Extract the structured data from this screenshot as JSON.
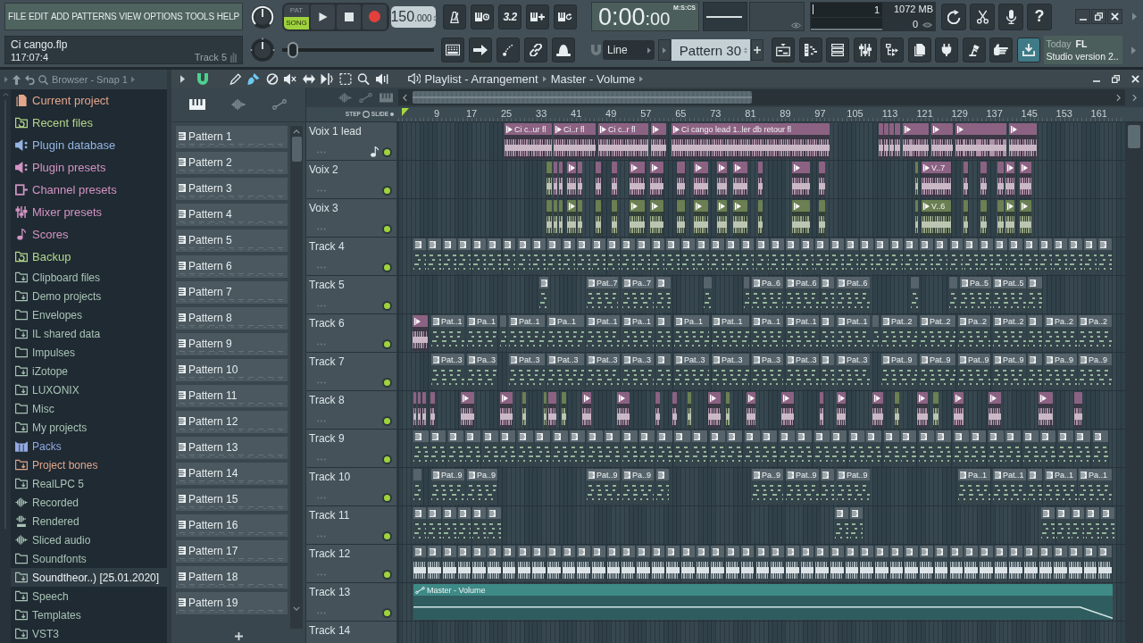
{
  "menu": [
    "FILE",
    "EDIT",
    "ADD",
    "PATTERNS",
    "VIEW",
    "OPTIONS",
    "TOOLS",
    "HELP"
  ],
  "project": {
    "file": "Ci cango.flp",
    "position": "117:07:4",
    "hint": "Track 5"
  },
  "transport": {
    "modes": [
      {
        "label": "PAT",
        "selected": false
      },
      {
        "label": "SONG",
        "selected": true
      }
    ],
    "tempo_whole": "150",
    "tempo_fraction": ".000",
    "countdown": "3.2",
    "pitch": {
      "level": 0.04
    }
  },
  "clock": {
    "time": "0:00",
    "fraction": ":00",
    "format": "M:S:CS"
  },
  "monitor": {
    "cpu": "1",
    "memory": "1072 MB",
    "voices": "0"
  },
  "help": "?",
  "snap": {
    "value": "Line"
  },
  "pattern_selector": {
    "value": "Pattern 30"
  },
  "news": {
    "date": "Today",
    "lines": [
      "FL",
      "Studio version 2.."
    ]
  },
  "browser": {
    "title": "Browser - Snap 1",
    "items": [
      {
        "label": "Current project",
        "kind": "document",
        "color": "#e2a58c",
        "selected": false
      },
      {
        "label": "Recent files",
        "kind": "recent",
        "color": "#b3d68a",
        "selected": false
      },
      {
        "label": "Plugin database",
        "kind": "plugin",
        "color": "#94b5e2",
        "selected": false
      },
      {
        "label": "Plugin presets",
        "kind": "plugin",
        "color": "#d493c4",
        "selected": false
      },
      {
        "label": "Channel presets",
        "kind": "channel",
        "color": "#d493c4",
        "selected": false
      },
      {
        "label": "Mixer presets",
        "kind": "mixer",
        "color": "#d493c4",
        "selected": false
      },
      {
        "label": "Scores",
        "kind": "note",
        "color": "#d493c4",
        "selected": false
      },
      {
        "label": "Backup",
        "kind": "recent",
        "color": "#b3d68a",
        "selected": false
      },
      {
        "label": "Clipboard files",
        "kind": "linked-folder",
        "color": "#a9c4b6",
        "selected": false
      },
      {
        "label": "Demo projects",
        "kind": "linked-folder",
        "color": "#a9c4b6",
        "selected": false
      },
      {
        "label": "Envelopes",
        "kind": "folder",
        "color": "#a9c4b6",
        "selected": false
      },
      {
        "label": "IL shared data",
        "kind": "linked-folder",
        "color": "#a9c4b6",
        "selected": false
      },
      {
        "label": "Impulses",
        "kind": "folder",
        "color": "#a9c4b6",
        "selected": false
      },
      {
        "label": "iZotope",
        "kind": "linked-folder",
        "color": "#a9c4b6",
        "selected": false
      },
      {
        "label": "LUXONIX",
        "kind": "linked-folder",
        "color": "#a9c4b6",
        "selected": false
      },
      {
        "label": "Misc",
        "kind": "folder",
        "color": "#a9c4b6",
        "selected": false
      },
      {
        "label": "My projects",
        "kind": "linked-folder",
        "color": "#a9c4b6",
        "selected": false
      },
      {
        "label": "Packs",
        "kind": "packs",
        "color": "#94a9e2",
        "selected": false
      },
      {
        "label": "Project bones",
        "kind": "linked-folder",
        "color": "#e2a58c",
        "selected": false
      },
      {
        "label": "RealLPC 5",
        "kind": "linked-folder",
        "color": "#a9c4b6",
        "selected": false
      },
      {
        "label": "Recorded",
        "kind": "audio",
        "color": "#a9c4b6",
        "selected": false
      },
      {
        "label": "Rendered",
        "kind": "render",
        "color": "#a9c4b6",
        "selected": false
      },
      {
        "label": "Sliced audio",
        "kind": "audio",
        "color": "#a9c4b6",
        "selected": false
      },
      {
        "label": "Soundfonts",
        "kind": "folder",
        "color": "#a9c4b6",
        "selected": false
      },
      {
        "label": "Soundtheor..) [25.01.2020]",
        "kind": "linked-folder",
        "color": "#a9c4b6",
        "selected": true
      },
      {
        "label": "Speech",
        "kind": "linked-folder",
        "color": "#a9c4b6",
        "selected": false
      },
      {
        "label": "Templates",
        "kind": "linked-folder",
        "color": "#a9c4b6",
        "selected": false
      },
      {
        "label": "VST3",
        "kind": "linked-folder",
        "color": "#a9c4b6",
        "selected": false
      }
    ]
  },
  "playlist": {
    "title": "Playlist - Arrangement",
    "target": "Master - Volume",
    "snap_on": true,
    "tools": [
      {
        "kind": "pencil",
        "selected": false
      },
      {
        "kind": "brush",
        "selected": true
      },
      {
        "kind": "delete",
        "selected": false
      },
      {
        "kind": "mute",
        "selected": false
      },
      {
        "kind": "slip",
        "selected": false
      },
      {
        "kind": "slice",
        "selected": false
      },
      {
        "kind": "select",
        "selected": false
      },
      {
        "kind": "zoom",
        "selected": false
      },
      {
        "kind": "playback",
        "selected": false
      }
    ],
    "filters": [
      {
        "kind": "patterns",
        "selected": true
      },
      {
        "kind": "audio",
        "selected": false
      },
      {
        "kind": "automation",
        "selected": false
      }
    ],
    "patterns": [
      "Pattern 1",
      "Pattern 2",
      "Pattern 3",
      "Pattern 4",
      "Pattern 5",
      "Pattern 6",
      "Pattern 7",
      "Pattern 8",
      "Pattern 9",
      "Pattern 10",
      "Pattern 11",
      "Pattern 12",
      "Pattern 13",
      "Pattern 14",
      "Pattern 15",
      "Pattern 16",
      "Pattern 17",
      "Pattern 18",
      "Pattern 19"
    ],
    "step_label": "STEP",
    "slide_label": "SLIDE",
    "bars": [
      "9",
      "17",
      "25",
      "33",
      "41",
      "49",
      "57",
      "65",
      "73",
      "81",
      "89",
      "97",
      "105",
      "113",
      "121",
      "129",
      "137",
      "145",
      "153",
      "161"
    ],
    "tracks": [
      {
        "name": "Voix 1 lead",
        "on": true,
        "instrument": true,
        "color": "#8c6283",
        "clips": [
          {
            "kind": "audio",
            "label": "Ci c..ur fl"
          },
          {
            "kind": "audio",
            "label": "Ci..r fl"
          },
          {
            "kind": "audio",
            "label": "Ci c..r fl"
          },
          {
            "kind": "audio"
          },
          {
            "kind": "audio",
            "label": "Ci cango lead 1..ler db retour fl"
          },
          {
            "kind": "audio"
          },
          {
            "kind": "audio"
          },
          {
            "kind": "audio"
          },
          {
            "kind": "audio"
          },
          {
            "kind": "audio"
          },
          {
            "kind": "audio"
          },
          {
            "kind": "audio"
          },
          {
            "kind": "audio"
          }
        ]
      },
      {
        "name": "Voix 2",
        "on": true,
        "instrument": false,
        "color": "#8c6283",
        "clips": [
          {
            "kind": "audio",
            "color": "#6b7f52"
          },
          {
            "kind": "audio"
          },
          {
            "kind": "audio"
          },
          {
            "kind": "audio"
          },
          {
            "kind": "audio"
          },
          {
            "kind": "audio"
          },
          {
            "kind": "audio"
          },
          {
            "kind": "audio"
          },
          {
            "kind": "audio"
          },
          {
            "kind": "audio"
          },
          {
            "kind": "audio"
          },
          {
            "kind": "audio"
          },
          {
            "kind": "audio"
          },
          {
            "kind": "audio"
          },
          {
            "kind": "audio"
          },
          {
            "kind": "audio"
          },
          {
            "kind": "audio",
            "color": "#6b7f52"
          },
          {
            "kind": "audio",
            "label": "V..7"
          },
          {
            "kind": "audio"
          },
          {
            "kind": "audio"
          },
          {
            "kind": "audio"
          },
          {
            "kind": "audio"
          },
          {
            "kind": "audio"
          }
        ]
      },
      {
        "name": "Voix 3",
        "on": true,
        "instrument": false,
        "color": "#6b7f52",
        "clips": [
          {
            "kind": "audio"
          },
          {
            "kind": "audio"
          },
          {
            "kind": "audio"
          },
          {
            "kind": "audio"
          },
          {
            "kind": "audio"
          },
          {
            "kind": "audio"
          },
          {
            "kind": "audio"
          },
          {
            "kind": "audio"
          },
          {
            "kind": "audio"
          },
          {
            "kind": "audio"
          },
          {
            "kind": "audio"
          },
          {
            "kind": "audio"
          },
          {
            "kind": "audio"
          },
          {
            "kind": "audio"
          },
          {
            "kind": "audio"
          },
          {
            "kind": "audio"
          },
          {
            "kind": "audio"
          },
          {
            "kind": "audio",
            "label": "V..6"
          },
          {
            "kind": "audio"
          },
          {
            "kind": "audio"
          },
          {
            "kind": "audio"
          },
          {
            "kind": "audio"
          },
          {
            "kind": "audio"
          }
        ]
      },
      {
        "name": "Track 4",
        "on": true,
        "instrument": false,
        "clips": [
          {
            "kind": "pattern"
          },
          {
            "kind": "pattern"
          },
          {
            "kind": "pattern"
          },
          {
            "kind": "pattern"
          },
          {
            "kind": "pattern"
          },
          {
            "kind": "pattern"
          },
          {
            "kind": "pattern"
          },
          {
            "kind": "pattern"
          },
          {
            "kind": "pattern"
          },
          {
            "kind": "pattern"
          },
          {
            "kind": "pattern"
          },
          {
            "kind": "pattern"
          },
          {
            "kind": "pattern"
          },
          {
            "kind": "pattern"
          },
          {
            "kind": "pattern"
          },
          {
            "kind": "pattern"
          },
          {
            "kind": "pattern"
          },
          {
            "kind": "pattern"
          },
          {
            "kind": "pattern"
          },
          {
            "kind": "pattern"
          },
          {
            "kind": "pattern"
          },
          {
            "kind": "pattern"
          },
          {
            "kind": "pattern"
          },
          {
            "kind": "pattern"
          },
          {
            "kind": "pattern"
          },
          {
            "kind": "pattern"
          },
          {
            "kind": "pattern"
          },
          {
            "kind": "pattern"
          },
          {
            "kind": "pattern"
          },
          {
            "kind": "pattern"
          },
          {
            "kind": "pattern"
          },
          {
            "kind": "pattern"
          },
          {
            "kind": "pattern"
          },
          {
            "kind": "pattern"
          },
          {
            "kind": "pattern"
          },
          {
            "kind": "pattern"
          },
          {
            "kind": "pattern"
          },
          {
            "kind": "pattern"
          },
          {
            "kind": "pattern"
          },
          {
            "kind": "pattern"
          },
          {
            "kind": "pattern"
          },
          {
            "kind": "pattern"
          },
          {
            "kind": "pattern"
          },
          {
            "kind": "pattern"
          },
          {
            "kind": "pattern"
          },
          {
            "kind": "pattern"
          },
          {
            "kind": "pattern"
          }
        ]
      },
      {
        "name": "Track 5",
        "on": true,
        "instrument": false,
        "clips": [
          {
            "kind": "pattern"
          },
          {
            "kind": "pattern",
            "label": "Pat..7"
          },
          {
            "kind": "pattern",
            "label": "Pa..7"
          },
          {
            "kind": "pattern"
          },
          {
            "kind": "pattern"
          },
          {
            "kind": "pattern"
          },
          {
            "kind": "pattern",
            "label": "Pa..6"
          },
          {
            "kind": "pattern",
            "label": "Pat..6"
          },
          {
            "kind": "pattern"
          },
          {
            "kind": "pattern",
            "label": "Pat..6"
          },
          {
            "kind": "pattern"
          },
          {
            "kind": "pattern"
          },
          {
            "kind": "pattern",
            "label": "Pa..5"
          },
          {
            "kind": "pattern",
            "label": "Pat..5"
          },
          {
            "kind": "pattern"
          }
        ]
      },
      {
        "name": "Track 6",
        "on": true,
        "instrument": false,
        "clips": [
          {
            "kind": "audio",
            "color": "#8c6283"
          },
          {
            "kind": "pattern",
            "label": "Pat..1"
          },
          {
            "kind": "pattern",
            "label": "Pa..1"
          },
          {
            "kind": "pattern"
          },
          {
            "kind": "pattern",
            "label": "Pat..1"
          },
          {
            "kind": "pattern",
            "label": "Pa..1"
          },
          {
            "kind": "pattern",
            "label": "Pat..1"
          },
          {
            "kind": "pattern",
            "label": "Pa..1"
          },
          {
            "kind": "pattern"
          },
          {
            "kind": "pattern",
            "label": "Pa..1"
          },
          {
            "kind": "pattern",
            "label": "Pat..1"
          },
          {
            "kind": "pattern",
            "label": "Pa..1"
          },
          {
            "kind": "pattern",
            "label": "Pat..1"
          },
          {
            "kind": "pattern"
          },
          {
            "kind": "pattern",
            "label": "Pat..1"
          },
          {
            "kind": "pattern"
          },
          {
            "kind": "pattern",
            "label": "Pat..2"
          },
          {
            "kind": "pattern",
            "label": "Pat..2"
          },
          {
            "kind": "pattern",
            "label": "Pa..2"
          },
          {
            "kind": "pattern",
            "label": "Pat..2"
          },
          {
            "kind": "pattern"
          },
          {
            "kind": "pattern",
            "label": "Pa..2"
          },
          {
            "kind": "pattern",
            "label": "Pa..2"
          }
        ]
      },
      {
        "name": "Track 7",
        "on": true,
        "instrument": false,
        "clips": [
          {
            "kind": "pattern",
            "label": "Pat..3"
          },
          {
            "kind": "pattern",
            "label": "Pa..3"
          },
          {
            "kind": "pattern",
            "label": "Pat..3"
          },
          {
            "kind": "pattern",
            "label": "Pat..3"
          },
          {
            "kind": "pattern",
            "label": "Pat..3"
          },
          {
            "kind": "pattern",
            "label": "Pa..3"
          },
          {
            "kind": "pattern"
          },
          {
            "kind": "pattern",
            "label": "Pat..3"
          },
          {
            "kind": "pattern",
            "label": "Pat..3"
          },
          {
            "kind": "pattern",
            "label": "Pa..3"
          },
          {
            "kind": "pattern",
            "label": "Pat..3"
          },
          {
            "kind": "pattern"
          },
          {
            "kind": "pattern",
            "label": "Pat..3"
          },
          {
            "kind": "pattern",
            "label": "Pat..9"
          },
          {
            "kind": "pattern",
            "label": "Pat..9"
          },
          {
            "kind": "pattern",
            "label": "Pat..9"
          },
          {
            "kind": "pattern",
            "label": "Pat..9"
          },
          {
            "kind": "pattern"
          },
          {
            "kind": "pattern",
            "label": "Pa..9"
          },
          {
            "kind": "pattern",
            "label": "Pa..9"
          }
        ]
      },
      {
        "name": "Track 8",
        "on": true,
        "instrument": false,
        "clips": [
          {
            "kind": "audio",
            "color": "#8c6283"
          },
          {
            "kind": "audio",
            "color": "#8c6283"
          },
          {
            "kind": "audio",
            "color": "#8c6283"
          },
          {
            "kind": "audio",
            "color": "#8c6283"
          },
          {
            "kind": "audio",
            "color": "#8c6283"
          },
          {
            "kind": "audio",
            "color": "#8c6283"
          },
          {
            "kind": "audio",
            "color": "#6b7f52"
          },
          {
            "kind": "audio",
            "color": "#6b7f52"
          },
          {
            "kind": "audio",
            "color": "#8c6283"
          },
          {
            "kind": "audio",
            "color": "#6b7f52"
          },
          {
            "kind": "audio",
            "color": "#8c6283"
          },
          {
            "kind": "audio",
            "color": "#8c6283"
          },
          {
            "kind": "audio",
            "color": "#8c6283"
          },
          {
            "kind": "audio",
            "color": "#8c6283"
          },
          {
            "kind": "audio",
            "color": "#6b7f52"
          },
          {
            "kind": "audio",
            "color": "#8c6283"
          },
          {
            "kind": "audio",
            "color": "#6b7f52"
          },
          {
            "kind": "audio",
            "color": "#8c6283"
          },
          {
            "kind": "audio",
            "color": "#8c6283"
          },
          {
            "kind": "audio",
            "color": "#8c6283"
          },
          {
            "kind": "audio",
            "color": "#8c6283"
          },
          {
            "kind": "audio",
            "color": "#8c6283"
          },
          {
            "kind": "audio",
            "color": "#6b7f52"
          },
          {
            "kind": "audio",
            "color": "#8c6283"
          },
          {
            "kind": "audio",
            "color": "#6b7f52"
          },
          {
            "kind": "audio",
            "color": "#8c6283"
          },
          {
            "kind": "audio",
            "color": "#8c6283"
          },
          {
            "kind": "audio",
            "color": "#8c6283"
          },
          {
            "kind": "audio",
            "color": "#8c6283"
          }
        ]
      },
      {
        "name": "Track 9",
        "on": true,
        "instrument": false,
        "clips": [
          {
            "kind": "pattern"
          },
          {
            "kind": "pattern"
          },
          {
            "kind": "pattern"
          },
          {
            "kind": "pattern"
          },
          {
            "kind": "pattern"
          },
          {
            "kind": "pattern"
          },
          {
            "kind": "pattern"
          },
          {
            "kind": "pattern"
          },
          {
            "kind": "pattern"
          },
          {
            "kind": "pattern"
          },
          {
            "kind": "pattern"
          },
          {
            "kind": "pattern"
          },
          {
            "kind": "pattern"
          },
          {
            "kind": "pattern"
          },
          {
            "kind": "pattern"
          },
          {
            "kind": "pattern"
          },
          {
            "kind": "pattern"
          },
          {
            "kind": "pattern"
          },
          {
            "kind": "pattern"
          },
          {
            "kind": "pattern"
          },
          {
            "kind": "pattern"
          },
          {
            "kind": "pattern"
          },
          {
            "kind": "pattern"
          },
          {
            "kind": "pattern"
          },
          {
            "kind": "pattern"
          },
          {
            "kind": "pattern"
          },
          {
            "kind": "pattern"
          },
          {
            "kind": "pattern"
          },
          {
            "kind": "pattern"
          },
          {
            "kind": "pattern"
          },
          {
            "kind": "pattern"
          },
          {
            "kind": "pattern"
          },
          {
            "kind": "pattern"
          },
          {
            "kind": "pattern"
          },
          {
            "kind": "pattern"
          },
          {
            "kind": "pattern"
          },
          {
            "kind": "pattern"
          },
          {
            "kind": "pattern"
          },
          {
            "kind": "pattern"
          },
          {
            "kind": "pattern"
          }
        ]
      },
      {
        "name": "Track 10",
        "on": true,
        "instrument": false,
        "clips": [
          {
            "kind": "pattern"
          },
          {
            "kind": "pattern",
            "label": "Pat..9"
          },
          {
            "kind": "pattern",
            "label": "Pa..9"
          },
          {
            "kind": "pattern",
            "label": "Pat..9"
          },
          {
            "kind": "pattern",
            "label": "Pa..9"
          },
          {
            "kind": "pattern"
          },
          {
            "kind": "pattern",
            "label": "Pa..9"
          },
          {
            "kind": "pattern",
            "label": "Pat..9"
          },
          {
            "kind": "pattern"
          },
          {
            "kind": "pattern",
            "label": "Pat..9"
          },
          {
            "kind": "pattern",
            "label": "Pa..1"
          },
          {
            "kind": "pattern",
            "label": "Pat..1"
          },
          {
            "kind": "pattern"
          },
          {
            "kind": "pattern",
            "label": "Pa..1"
          },
          {
            "kind": "pattern",
            "label": "Pa..1"
          }
        ]
      },
      {
        "name": "Track 11",
        "on": true,
        "instrument": false,
        "clips": [
          {
            "kind": "pattern"
          },
          {
            "kind": "pattern"
          },
          {
            "kind": "pattern"
          },
          {
            "kind": "pattern"
          },
          {
            "kind": "pattern"
          },
          {
            "kind": "pattern"
          },
          {
            "kind": "pattern"
          },
          {
            "kind": "pattern"
          },
          {
            "kind": "pattern"
          },
          {
            "kind": "pattern"
          },
          {
            "kind": "pattern"
          },
          {
            "kind": "pattern"
          },
          {
            "kind": "pattern"
          }
        ]
      },
      {
        "name": "Track 12",
        "on": true,
        "instrument": false,
        "clips": [
          {
            "kind": "sample"
          },
          {
            "kind": "sample"
          },
          {
            "kind": "sample"
          },
          {
            "kind": "sample"
          },
          {
            "kind": "sample"
          },
          {
            "kind": "sample"
          },
          {
            "kind": "sample"
          },
          {
            "kind": "sample"
          },
          {
            "kind": "sample"
          },
          {
            "kind": "sample"
          },
          {
            "kind": "sample"
          },
          {
            "kind": "sample"
          },
          {
            "kind": "sample"
          },
          {
            "kind": "sample"
          },
          {
            "kind": "sample"
          },
          {
            "kind": "sample"
          },
          {
            "kind": "sample"
          },
          {
            "kind": "sample"
          },
          {
            "kind": "sample"
          },
          {
            "kind": "sample"
          },
          {
            "kind": "sample"
          },
          {
            "kind": "sample"
          },
          {
            "kind": "sample"
          },
          {
            "kind": "sample"
          },
          {
            "kind": "sample"
          },
          {
            "kind": "sample"
          },
          {
            "kind": "sample"
          },
          {
            "kind": "sample"
          },
          {
            "kind": "sample"
          },
          {
            "kind": "sample"
          },
          {
            "kind": "sample"
          },
          {
            "kind": "sample"
          },
          {
            "kind": "sample"
          },
          {
            "kind": "sample"
          },
          {
            "kind": "sample"
          },
          {
            "kind": "sample"
          },
          {
            "kind": "sample"
          },
          {
            "kind": "sample"
          },
          {
            "kind": "sample"
          },
          {
            "kind": "sample"
          },
          {
            "kind": "sample"
          },
          {
            "kind": "sample"
          },
          {
            "kind": "sample"
          },
          {
            "kind": "sample"
          },
          {
            "kind": "sample"
          },
          {
            "kind": "sample"
          },
          {
            "kind": "sample"
          }
        ]
      },
      {
        "name": "Track 13",
        "on": true,
        "instrument": false,
        "clips": [
          {
            "kind": "automation",
            "label": "Master - Volume"
          }
        ]
      },
      {
        "name": "Track 14"
      }
    ]
  }
}
